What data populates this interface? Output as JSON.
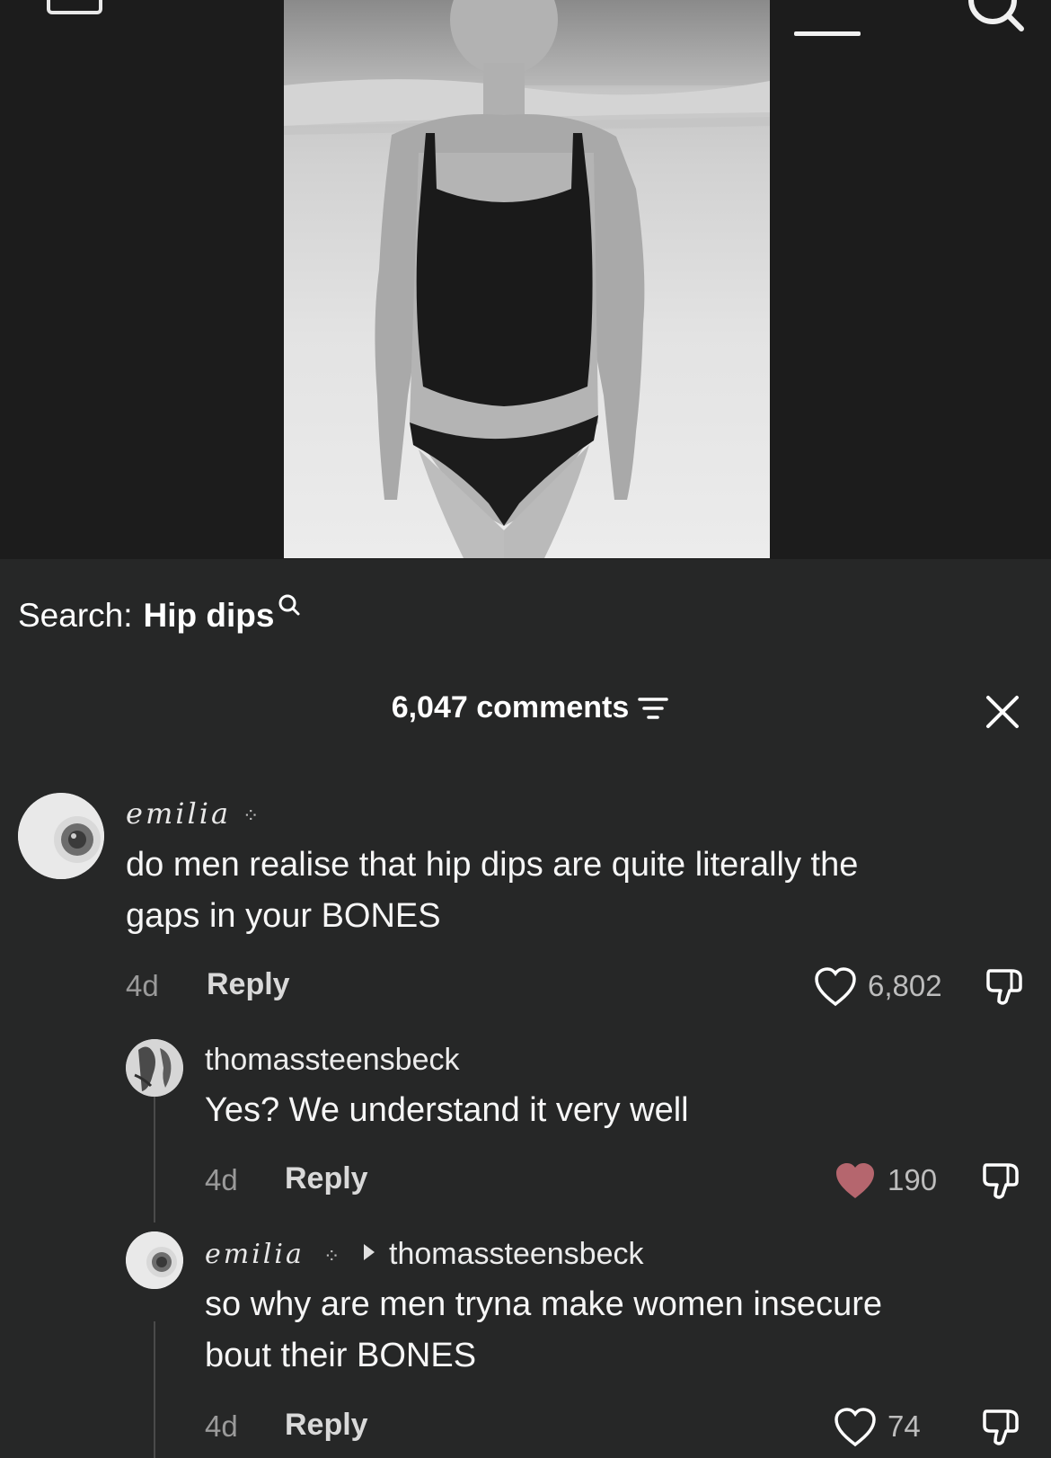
{
  "search": {
    "label": "Search:",
    "query": "Hip dips"
  },
  "comments": {
    "count_label": "6,047 comments"
  },
  "thread": [
    {
      "username": "emilia",
      "sparkle": "⁘",
      "text_line1": "do men realise that hip dips are quite literally the",
      "text_line2": "gaps in your BONES",
      "age": "4d",
      "reply": "Reply",
      "likes": "6,802"
    },
    {
      "username": "thomassteensbeck",
      "text": "Yes? We understand it very well",
      "age": "4d",
      "reply": "Reply",
      "likes": "190"
    },
    {
      "username": "emilia",
      "sparkle": "⁘",
      "reply_to": "thomassteensbeck",
      "text_line1": "so why are men tryna make women insecure",
      "text_line2": "bout their BONES",
      "age": "4d",
      "reply": "Reply",
      "likes": "74"
    }
  ],
  "colors": {
    "liked_heart": "#b5666e",
    "background": "#262727"
  }
}
